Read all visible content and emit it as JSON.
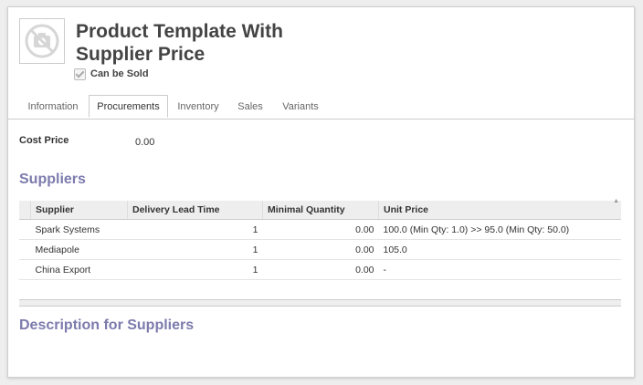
{
  "product": {
    "title": "Product Template With Supplier Price",
    "can_be_sold_label": "Can be Sold",
    "can_be_sold_checked": true,
    "image_icon": "no-image-camera-icon"
  },
  "tabs": [
    {
      "label": "Information",
      "active": false
    },
    {
      "label": "Procurements",
      "active": true
    },
    {
      "label": "Inventory",
      "active": false
    },
    {
      "label": "Sales",
      "active": false
    },
    {
      "label": "Variants",
      "active": false
    }
  ],
  "cost_price": {
    "label": "Cost Price",
    "value": "0.00"
  },
  "suppliers": {
    "title": "Suppliers",
    "columns": [
      "Supplier",
      "Delivery Lead Time",
      "Minimal Quantity",
      "Unit Price"
    ],
    "rows": [
      {
        "supplier": "Spark Systems",
        "lead_time": "1",
        "min_qty": "0.00",
        "unit_price": "100.0 (Min Qty: 1.0) >> 95.0 (Min Qty: 50.0)"
      },
      {
        "supplier": "Mediapole",
        "lead_time": "1",
        "min_qty": "0.00",
        "unit_price": "105.0"
      },
      {
        "supplier": "China Export",
        "lead_time": "1",
        "min_qty": "0.00",
        "unit_price": "-"
      }
    ]
  },
  "description_suppliers": {
    "title": "Description for Suppliers"
  },
  "colors": {
    "section_title": "#7c7bad",
    "background": "#eeeeee"
  }
}
